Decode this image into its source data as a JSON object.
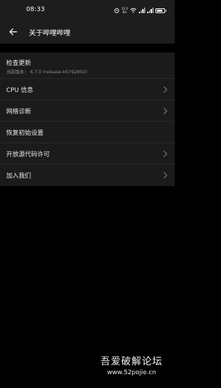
{
  "status_bar": {
    "time": "08:33",
    "net_speed_value": "11.5",
    "net_speed_unit": "K/s",
    "battery_percent": 78,
    "icons": [
      "alarm-icon",
      "wifi-icon",
      "signal-icon",
      "signal-icon",
      "battery-icon"
    ]
  },
  "header": {
    "back_icon": "arrow-left",
    "title": "关于哔哩哔哩"
  },
  "settings": {
    "items": [
      {
        "label": "检查更新",
        "sub": "当前版本： 6.7.0   (release-b5792802)",
        "chevron": false
      },
      {
        "label": "CPU 信息",
        "chevron": true
      },
      {
        "label": "网络诊断",
        "chevron": true
      },
      {
        "label": "恢复初始设置",
        "chevron": false
      },
      {
        "label": "开放源代码许可",
        "chevron": true
      },
      {
        "label": "加入我们",
        "chevron": true
      }
    ]
  },
  "watermark": {
    "text": "吾爱破解论坛",
    "url": "www.52pojie.cn"
  },
  "colors": {
    "background": "#000000",
    "bar": "#1d1d1d",
    "list": "#1b1b1b",
    "text": "#e9e9e9",
    "subtext": "#8d8d8d"
  }
}
